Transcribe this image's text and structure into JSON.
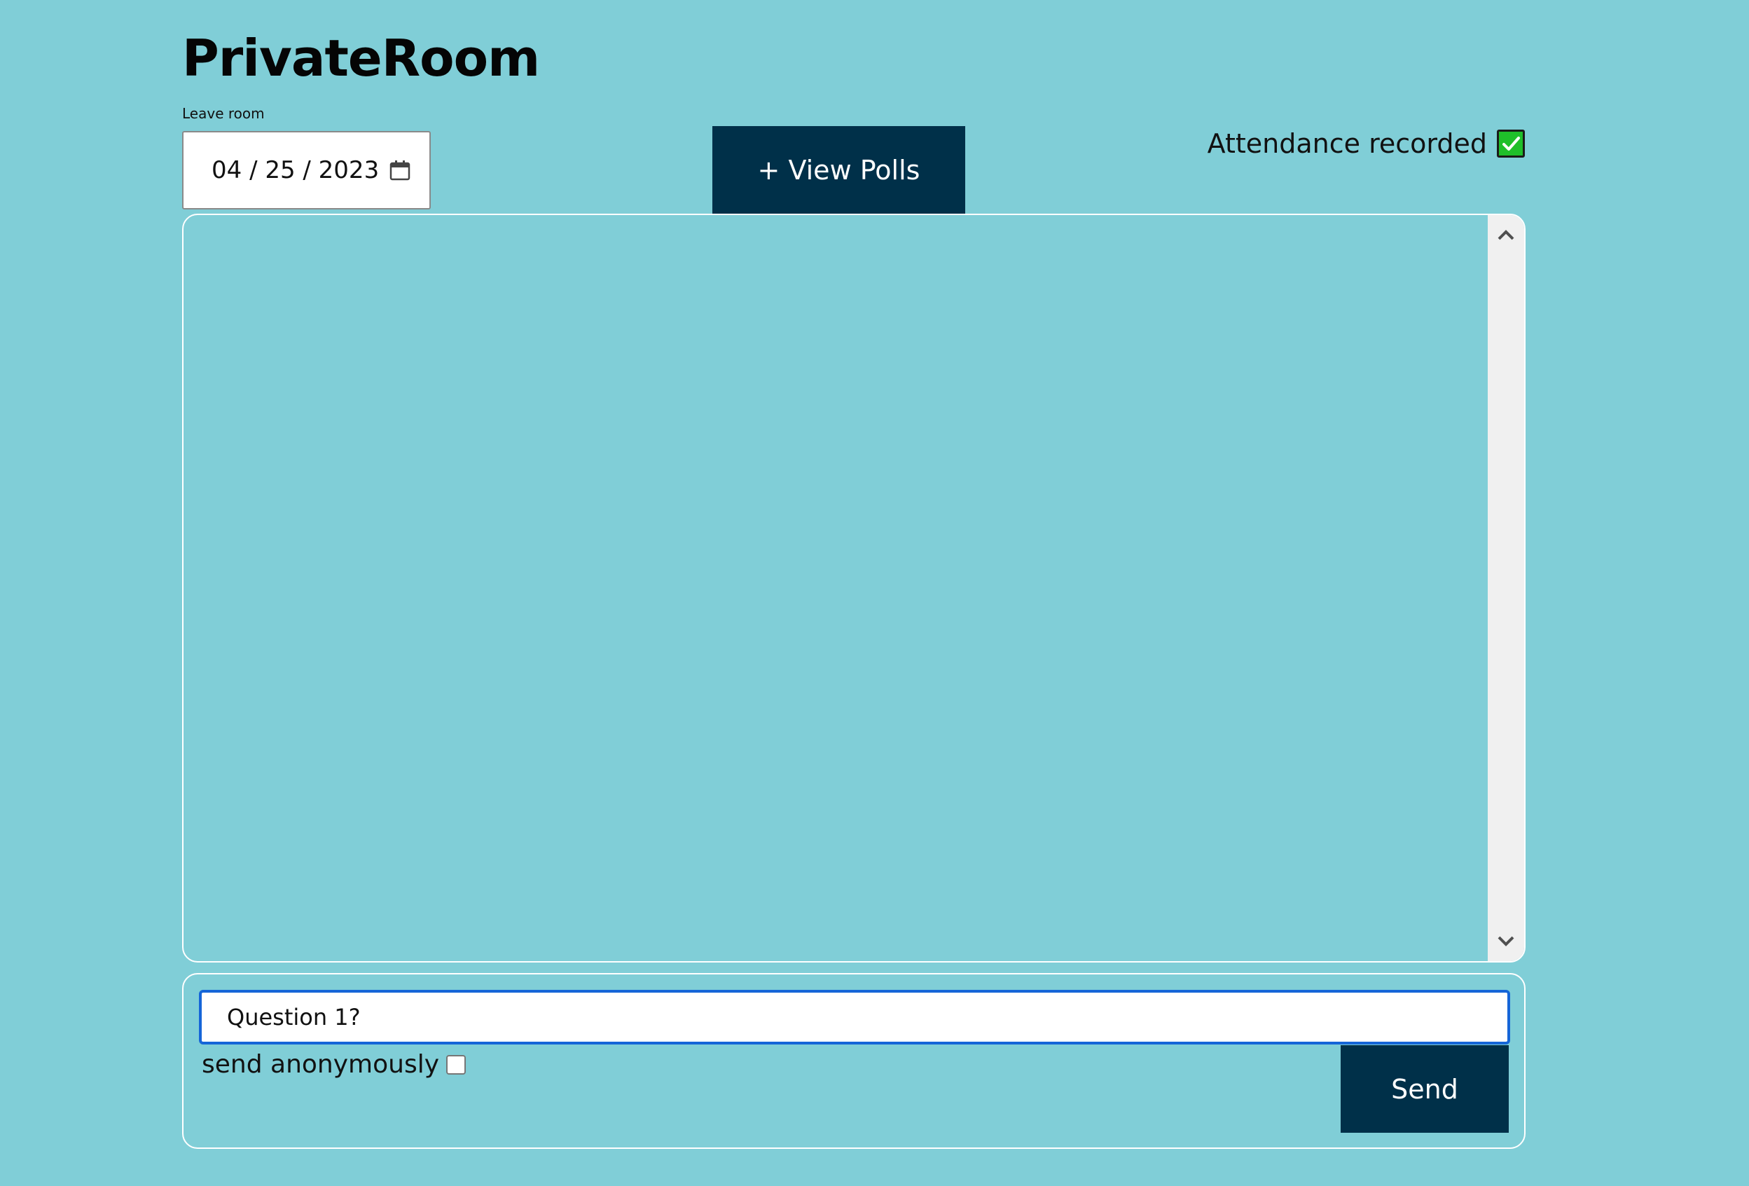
{
  "header": {
    "title": "PrivateRoom",
    "leave_room_label": "Leave room"
  },
  "date_picker": {
    "value": "04 / 25 / 2023",
    "icon": "calendar-icon"
  },
  "polls": {
    "button_label": "+ View Polls"
  },
  "attendance": {
    "label": "Attendance recorded",
    "checked": true,
    "check_color": "#1fbf2a"
  },
  "messages": {
    "items": []
  },
  "compose": {
    "input_value": "Question 1?",
    "anonymous_label": "send anonymously",
    "anonymous_checked": false,
    "send_label": "Send"
  },
  "colors": {
    "background": "#80ced7",
    "button": "#003049",
    "input_focus": "#1565d8"
  }
}
